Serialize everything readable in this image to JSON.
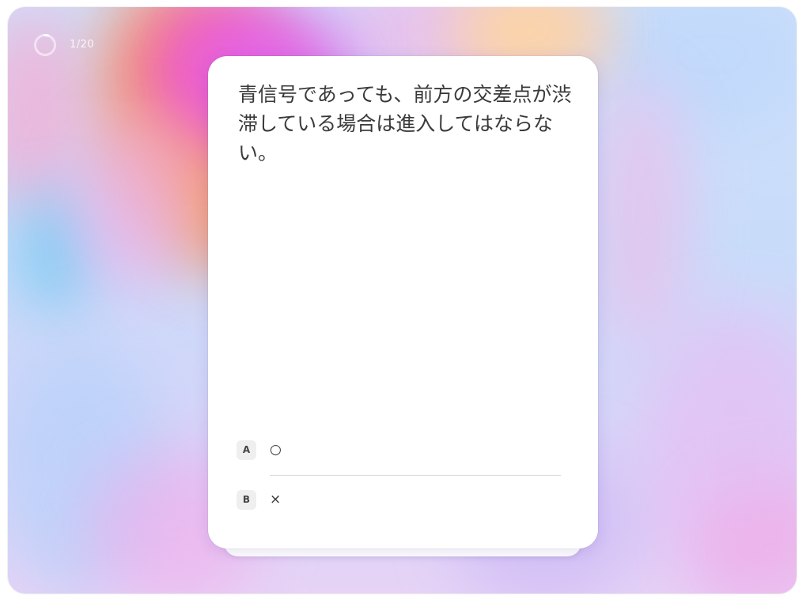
{
  "progress": {
    "counter_text": "1/20",
    "fraction": 0.05
  },
  "question": {
    "text": "青信号であっても、前方の交差点が渋滞している場合は進入してはならない。"
  },
  "options": [
    {
      "key": "A",
      "label": "○"
    },
    {
      "key": "B",
      "label": "×"
    }
  ],
  "colors": {
    "card": "#ffffff",
    "text": "#3a3a3a",
    "key_bg": "#efefef"
  }
}
